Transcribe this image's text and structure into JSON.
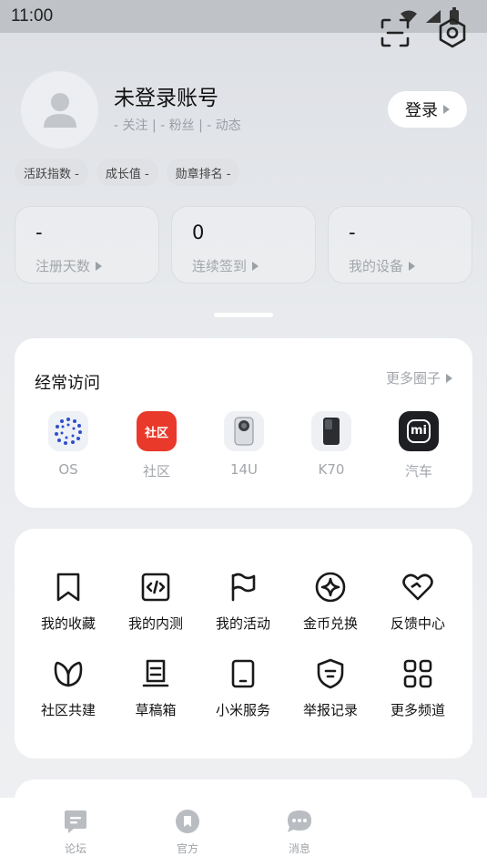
{
  "status_bar": {
    "time": "11:00"
  },
  "profile": {
    "username": "未登录账号",
    "follow_line": "- 关注 | - 粉丝 | - 动态",
    "login_label": "登录"
  },
  "chips": [
    "活跃指数 -",
    "成长值 -",
    "勋章排名 -"
  ],
  "stats": [
    {
      "value": "-",
      "label": "注册天数"
    },
    {
      "value": "0",
      "label": "连续签到"
    },
    {
      "value": "-",
      "label": "我的设备"
    }
  ],
  "frequent": {
    "title": "经常访问",
    "more_label": "更多圈子",
    "items": [
      {
        "label": "OS",
        "icon": "os-logo-icon"
      },
      {
        "label": "社区",
        "icon": "community-logo-icon",
        "badge": "社区"
      },
      {
        "label": "14U",
        "icon": "phone-14u-icon"
      },
      {
        "label": "K70",
        "icon": "phone-k70-icon"
      },
      {
        "label": "汽车",
        "icon": "mi-logo-icon",
        "badge": "mi"
      }
    ]
  },
  "features": [
    {
      "label": "我的收藏",
      "icon": "bookmark-icon"
    },
    {
      "label": "我的内测",
      "icon": "code-icon"
    },
    {
      "label": "我的活动",
      "icon": "flag-icon"
    },
    {
      "label": "金币兑换",
      "icon": "coin-icon"
    },
    {
      "label": "反馈中心",
      "icon": "heart-icon"
    },
    {
      "label": "社区共建",
      "icon": "leaf-icon"
    },
    {
      "label": "草稿箱",
      "icon": "draft-icon"
    },
    {
      "label": "小米服务",
      "icon": "tablet-icon"
    },
    {
      "label": "举报记录",
      "icon": "shield-icon"
    },
    {
      "label": "更多频道",
      "icon": "grid-icon"
    }
  ],
  "tabs": [
    {
      "label": "论坛",
      "icon": "forum-icon"
    },
    {
      "label": "官方",
      "icon": "official-icon"
    },
    {
      "label": "消息",
      "icon": "message-icon"
    }
  ],
  "colors": {
    "community_red": "#e8392a",
    "mi_dark": "#1d1f22",
    "os_blue": "#3b5bdb"
  }
}
